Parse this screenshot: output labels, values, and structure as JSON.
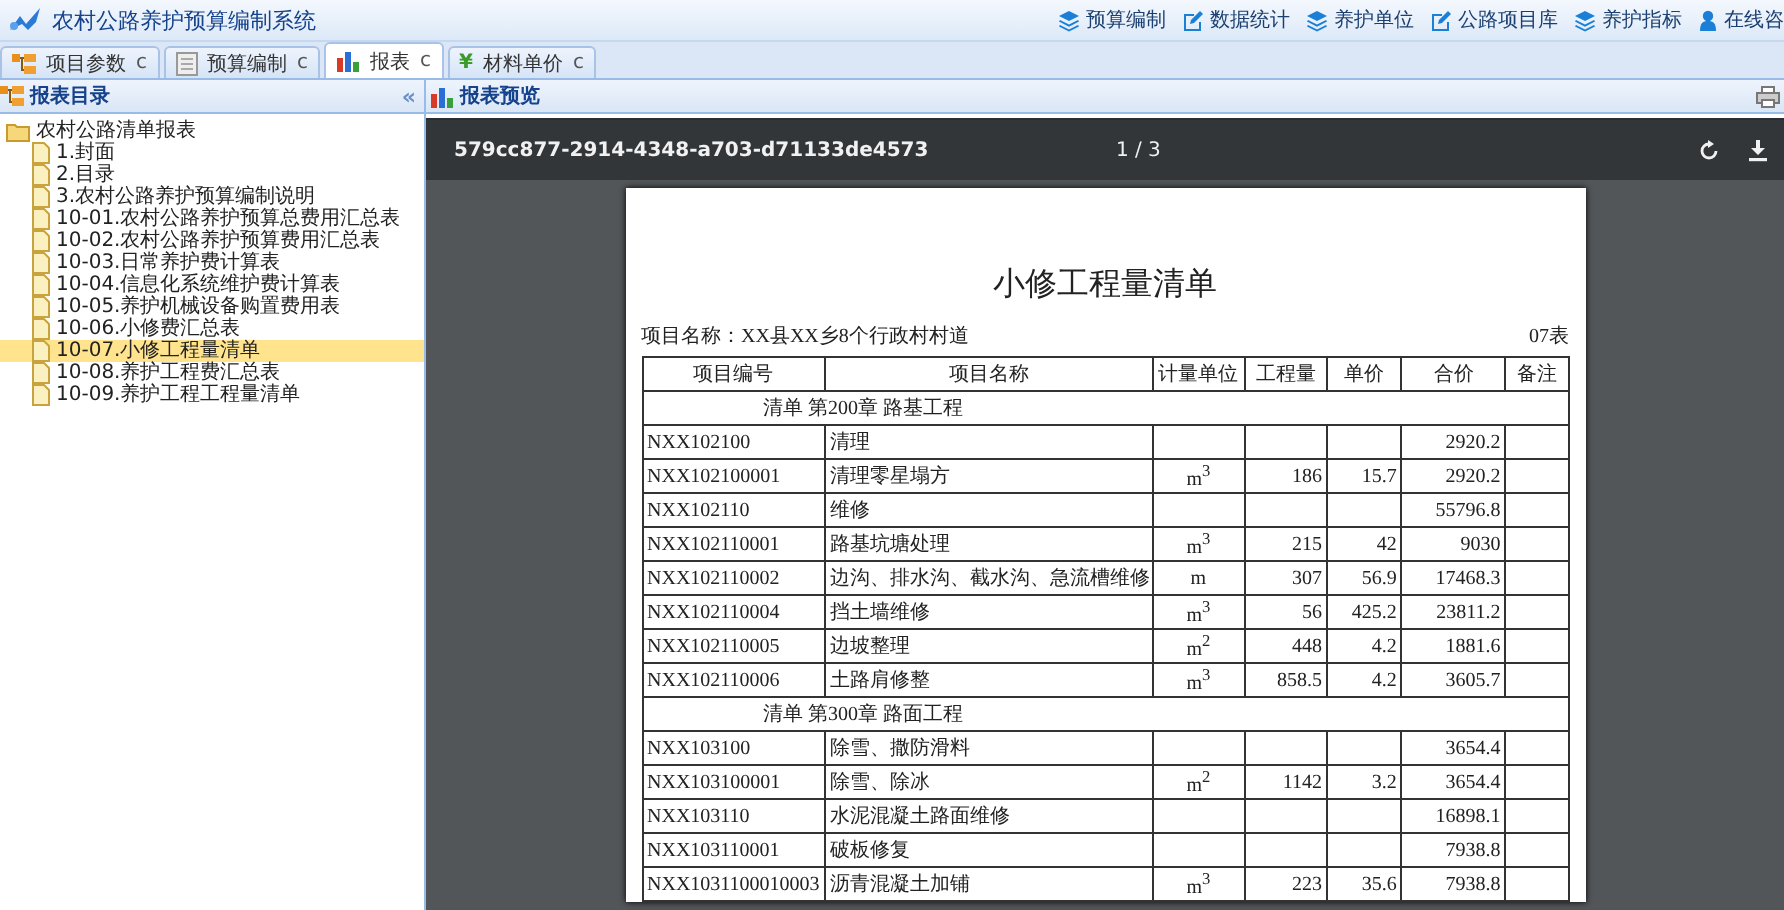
{
  "app": {
    "title": "农村公路养护预算编制系统"
  },
  "nav": [
    {
      "kind": "layers",
      "label": "预算编制"
    },
    {
      "kind": "edit",
      "label": "数据统计"
    },
    {
      "kind": "layers",
      "label": "养护单位"
    },
    {
      "kind": "edit",
      "label": "公路项目库"
    },
    {
      "kind": "layers",
      "label": "养护指标"
    },
    {
      "kind": "user",
      "label": "在线咨"
    }
  ],
  "tabs": [
    {
      "kind": "tree",
      "label": "项目参数",
      "close": "c",
      "selected": false
    },
    {
      "kind": "doc",
      "label": "预算编制",
      "close": "c",
      "selected": false
    },
    {
      "kind": "chart",
      "label": "报表",
      "close": "c",
      "selected": true
    },
    {
      "kind": "char",
      "symbol": "¥",
      "label": "材料单价",
      "close": "c",
      "selected": false
    }
  ],
  "sidebar": {
    "title": "报表目录",
    "collapse": "«",
    "tree": [
      {
        "label": "农村公路清单报表",
        "selected": false,
        "children": [
          {
            "label": "1.封面",
            "selected": false
          },
          {
            "label": "2.目录",
            "selected": false
          },
          {
            "label": "3.农村公路养护预算编制说明",
            "selected": false
          },
          {
            "label": "10-01.农村公路养护预算总费用汇总表",
            "selected": false
          },
          {
            "label": "10-02.农村公路养护预算费用汇总表",
            "selected": false
          },
          {
            "label": "10-03.日常养护费计算表",
            "selected": false
          },
          {
            "label": "10-04.信息化系统维护费计算表",
            "selected": false
          },
          {
            "label": "10-05.养护机械设备购置费用表",
            "selected": false
          },
          {
            "label": "10-06.小修费汇总表",
            "selected": false
          },
          {
            "label": "10-07.小修工程量清单",
            "selected": true
          },
          {
            "label": "10-08.养护工程费汇总表",
            "selected": false
          },
          {
            "label": "10-09.养护工程工程量清单",
            "selected": false
          }
        ]
      }
    ]
  },
  "preview": {
    "title": "报表预览",
    "toolbar": {
      "file_id": "579cc877-2914-4348-a703-d71133de4573",
      "page": "1 / 3"
    },
    "document": {
      "title": "小修工程量清单",
      "project": "项目名称：XX县XX乡8个行政村村道",
      "table_no": "07表",
      "columns": [
        "项目编号",
        "项目名称",
        "计量单位",
        "工程量",
        "单价",
        "合价",
        "备注"
      ],
      "rows": [
        {
          "kind": "section",
          "label": "清单 第200章 路基工程"
        },
        {
          "kind": "item",
          "cells": [
            "NXX102100",
            "清理",
            "",
            "",
            "",
            "2920.2",
            ""
          ]
        },
        {
          "kind": "item",
          "cells": [
            "NXX102100001",
            "清理零星塌方",
            "m$^{3}$",
            "186",
            "15.7",
            "2920.2",
            ""
          ]
        },
        {
          "kind": "item",
          "cells": [
            "NXX102110",
            "维修",
            "",
            "",
            "",
            "55796.8",
            ""
          ]
        },
        {
          "kind": "item",
          "cells": [
            "NXX102110001",
            "路基坑塘处理",
            "m$^{3}$",
            "215",
            "42",
            "9030",
            ""
          ]
        },
        {
          "kind": "item",
          "cells": [
            "NXX102110002",
            "边沟、排水沟、截水沟、急流槽维修",
            "m",
            "307",
            "56.9",
            "17468.3",
            ""
          ]
        },
        {
          "kind": "item",
          "cells": [
            "NXX102110004",
            "挡土墙维修",
            "m$^{3}$",
            "56",
            "425.2",
            "23811.2",
            ""
          ]
        },
        {
          "kind": "item",
          "cells": [
            "NXX102110005",
            "边坡整理",
            "m$^{2}$",
            "448",
            "4.2",
            "1881.6",
            ""
          ]
        },
        {
          "kind": "item",
          "cells": [
            "NXX102110006",
            "土路肩修整",
            "m$^{3}$",
            "858.5",
            "4.2",
            "3605.7",
            ""
          ]
        },
        {
          "kind": "section",
          "label": "清单 第300章 路面工程"
        },
        {
          "kind": "item",
          "cells": [
            "NXX103100",
            "除雪、撒防滑料",
            "",
            "",
            "",
            "3654.4",
            ""
          ]
        },
        {
          "kind": "item",
          "cells": [
            "NXX103100001",
            "除雪、除冰",
            "m$^{2}$",
            "1142",
            "3.2",
            "3654.4",
            ""
          ]
        },
        {
          "kind": "item",
          "cells": [
            "NXX103110",
            "水泥混凝土路面维修",
            "",
            "",
            "",
            "16898.1",
            ""
          ]
        },
        {
          "kind": "item",
          "cells": [
            "NXX103110001",
            "破板修复",
            "",
            "",
            "",
            "7938.8",
            ""
          ]
        },
        {
          "kind": "item",
          "cells": [
            "NXX1031100010003",
            "沥青混凝土加铺",
            "m$^{3}$",
            "223",
            "35.6",
            "7938.8",
            ""
          ]
        }
      ]
    }
  }
}
